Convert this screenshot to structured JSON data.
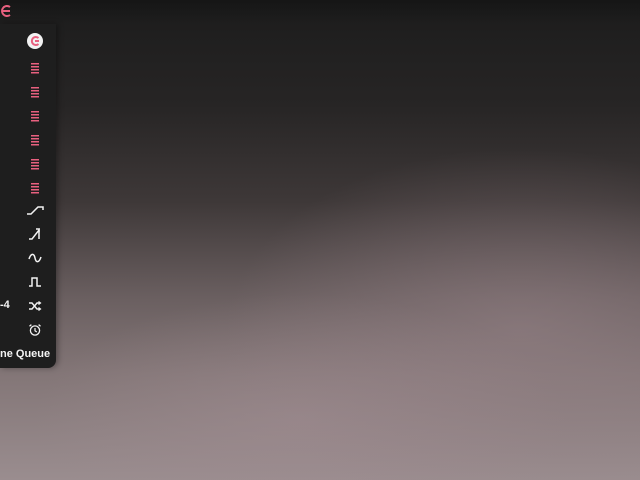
{
  "colors": {
    "accent": "#e8607f",
    "icon_white": "#f2f2f2",
    "sidebar_bg": "#1e1e1e"
  },
  "top_logo": {
    "icon": "logo-c-icon"
  },
  "sidebar": {
    "items": [
      {
        "icon": "app-logo-icon"
      },
      {
        "icon": "list-icon"
      },
      {
        "icon": "list-icon"
      },
      {
        "icon": "list-icon"
      },
      {
        "icon": "list-icon"
      },
      {
        "icon": "list-icon"
      },
      {
        "icon": "list-icon"
      },
      {
        "icon": "ramp-icon"
      },
      {
        "icon": "sawtooth-icon"
      },
      {
        "icon": "sine-wave-icon"
      },
      {
        "icon": "square-wave-icon"
      },
      {
        "icon": "shuffle-icon"
      },
      {
        "icon": "alarm-clock-icon"
      }
    ],
    "shuffle_label": "-4",
    "queue_label": "ne Queue"
  }
}
